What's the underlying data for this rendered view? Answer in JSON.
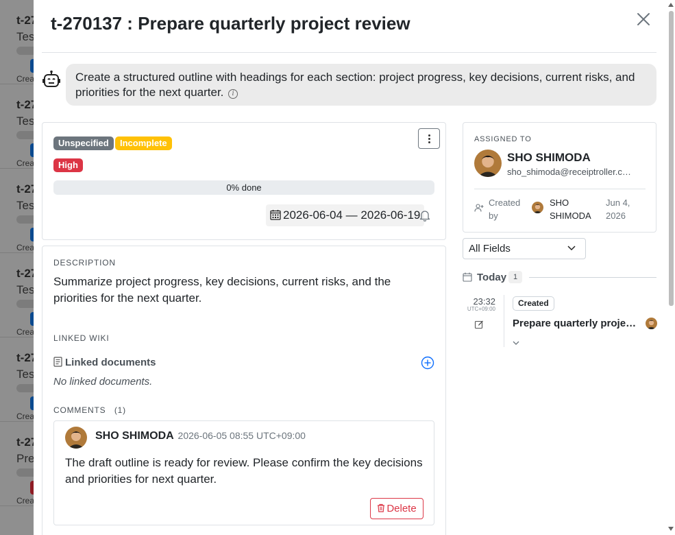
{
  "background_list": {
    "cards": [
      {
        "id": "t-27",
        "title": "Tes",
        "created": "Crea",
        "badge_color": "#0b4a8f"
      },
      {
        "id": "t-27",
        "title": "Tes",
        "created": "Crea",
        "badge_color": "#0b4a8f"
      },
      {
        "id": "t-27",
        "title": "Tes",
        "created": "Crea",
        "badge_color": "#0b4a8f"
      },
      {
        "id": "t-27",
        "title": "Tes",
        "created": "Crea",
        "badge_color": "#0b4a8f"
      },
      {
        "id": "t-27",
        "title": "Tes",
        "created": "Crea",
        "badge_color": "#0b4a8f"
      },
      {
        "id": "t-27",
        "title": "Pre",
        "created": "Crea",
        "badge_color": "#8e1c24"
      }
    ]
  },
  "modal": {
    "title": "t-270137 : Prepare quarterly project review",
    "close_icon": "close-icon",
    "ai_prompt": {
      "icon": "robot-icon",
      "text": "Create a structured outline with headings for each section: project progress, key decisions, current risks, and priorities for the next quarter.",
      "info_glyph": "i"
    },
    "status_card": {
      "badges": {
        "category": "Unspecified",
        "status": "Incomplete",
        "priority": "High"
      },
      "progress": {
        "label": "0% done",
        "value": 0
      },
      "date_range": "2026-06-04 — 2026-06-19"
    },
    "details_card": {
      "description_label": "DESCRIPTION",
      "description": "Summarize project progress, key decisions, current risks, and the priorities for the next quarter.",
      "linked_wiki_label": "LINKED WIKI",
      "linked_documents_label": "Linked documents",
      "no_linked_documents": "No linked documents.",
      "comments_label": "COMMENTS",
      "comments_count": "(1)",
      "comments": [
        {
          "author": "SHO SHIMODA",
          "time": "2026-06-05 08:55 UTC+09:00",
          "text": "The draft outline is ready for review. Please confirm the key decisions and priorities for next quarter.",
          "delete_label": "Delete"
        }
      ]
    },
    "assignee_card": {
      "label": "ASSIGNED TO",
      "name": "SHO SHIMODA",
      "email": "sho_shimoda@receiptroller.com",
      "created_by_label": "Created by",
      "created_by_name": "SHO SHIMODA",
      "created_date": "Jun 4, 2026"
    },
    "fields_filter": {
      "selected": "All Fields"
    },
    "timeline": {
      "group_label": "Today",
      "group_count": "1",
      "entries": [
        {
          "time": "23:32",
          "timezone": "UTC+09:00",
          "action": "Created",
          "title": "Prepare quarterly project review"
        }
      ]
    }
  },
  "colors": {
    "danger": "#dc3545",
    "warning": "#ffc107",
    "secondary": "#6c757d",
    "primary": "#0d6efd"
  }
}
